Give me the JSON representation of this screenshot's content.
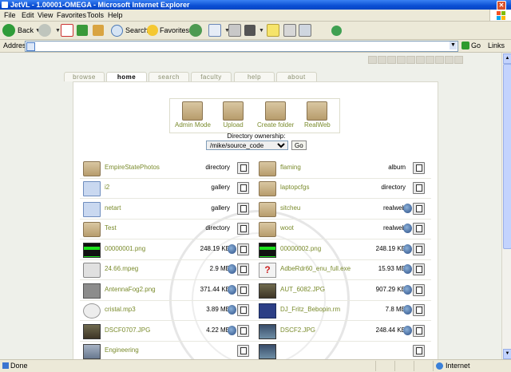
{
  "window": {
    "title": "JetVL - 1.00001-OMEGA - Microsoft Internet Explorer",
    "close_glyph": "✕"
  },
  "menu": [
    "File",
    "Edit",
    "View",
    "Favorites",
    "Tools",
    "Help"
  ],
  "toolbar": {
    "back_label": "Back",
    "search_label": "Search",
    "favorites_label": "Favorites"
  },
  "address": {
    "label": "Address",
    "value": "",
    "go_label": "Go",
    "links_label": "Links"
  },
  "site": {
    "tabs": [
      "browse",
      "home",
      "search",
      "faculty",
      "help",
      "about"
    ],
    "active_tab": "home",
    "actions": [
      "Admin Mode",
      "Upload",
      "Create folder",
      "RealWeb"
    ],
    "ownership_label": "Directory ownership:",
    "ownership_value": "/mike/source_code",
    "ownership_go": "Go"
  },
  "files": [
    {
      "left": {
        "name": "EmpireStatePhotos",
        "type": "directory",
        "icon": "folder-icon"
      },
      "right": {
        "name": "flaming",
        "type": "album",
        "icon": "folder-icon"
      }
    },
    {
      "left": {
        "name": "i2",
        "type": "gallery",
        "icon": "gallery-icon"
      },
      "right": {
        "name": "laptopcfgs",
        "type": "directory",
        "icon": "folder-icon"
      }
    },
    {
      "left": {
        "name": "netart",
        "type": "gallery",
        "icon": "gallery-icon"
      },
      "right": {
        "name": "sitcheu",
        "type": "realweb",
        "icon": "folder-icon"
      }
    },
    {
      "left": {
        "name": "Test",
        "type": "directory",
        "icon": "folder-icon"
      },
      "right": {
        "name": "woot",
        "type": "realweb",
        "icon": "folder-icon"
      }
    },
    {
      "left": {
        "name": "00000001.png",
        "type": "248.19 KB",
        "icon": "png-thumb-icon"
      },
      "right": {
        "name": "00000002.png",
        "type": "248.19 KB",
        "icon": "png-thumb-icon"
      }
    },
    {
      "left": {
        "name": "24.66.mpeg",
        "type": "2.9 MB",
        "icon": "mpeg-icon"
      },
      "right": {
        "name": "AdbeRdr60_enu_full.exe",
        "type": "15.93 MB",
        "icon": "unknown-file-icon"
      }
    },
    {
      "left": {
        "name": "AntennaFog2.png",
        "type": "371.44 KB",
        "icon": "image-thumb-icon"
      },
      "right": {
        "name": "AUT_6082.JPG",
        "type": "907.29 KB",
        "icon": "image-thumb-icon"
      }
    },
    {
      "left": {
        "name": "cristal.mp3",
        "type": "3.89 MB",
        "icon": "mp3-icon"
      },
      "right": {
        "name": "DJ_Fritz_Bebopin.rm",
        "type": "7.8 MB",
        "icon": "realmedia-icon"
      }
    },
    {
      "left": {
        "name": "DSCF0707.JPG",
        "type": "4.22 MB",
        "icon": "photo-thumb-icon"
      },
      "right": {
        "name": "DSCF2.JPG",
        "type": "248.44 KB",
        "icon": "photo-thumb-icon"
      }
    },
    {
      "left": {
        "name": "Engineering",
        "type": "",
        "icon": "photo-thumb-icon"
      },
      "right": {
        "name": "",
        "type": "",
        "icon": "photo-thumb-icon"
      }
    }
  ],
  "status": {
    "text": "Done",
    "zone": "Internet"
  }
}
